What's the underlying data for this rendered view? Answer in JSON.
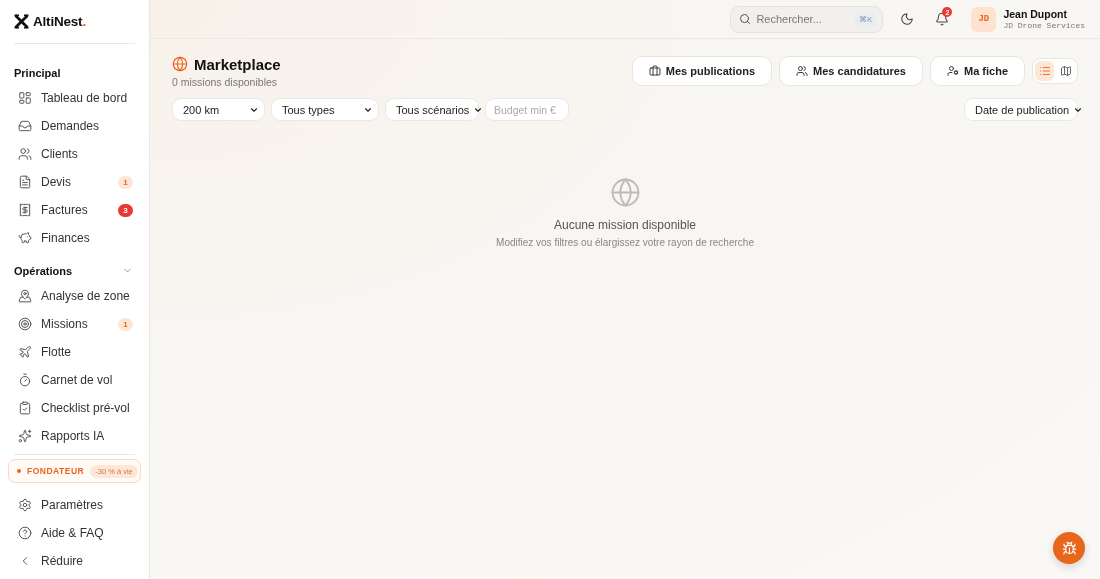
{
  "sidebar": {
    "logo": {
      "name": "AltiNest",
      "mark": "."
    },
    "sections": [
      {
        "title": "Principal",
        "items": [
          {
            "label": "Tableau de bord"
          },
          {
            "label": "Demandes"
          },
          {
            "label": "Clients"
          },
          {
            "label": "Devis",
            "badge": {
              "text": "1",
              "kind": "soft"
            }
          },
          {
            "label": "Factures",
            "badge": {
              "text": "3",
              "kind": "alert"
            }
          },
          {
            "label": "Finances"
          }
        ]
      },
      {
        "title": "Opérations",
        "expanded": true,
        "items": [
          {
            "label": "Analyse de zone"
          },
          {
            "label": "Missions",
            "badge": {
              "text": "1",
              "kind": "soft"
            }
          },
          {
            "label": "Flotte"
          },
          {
            "label": "Carnet de vol"
          },
          {
            "label": "Checklist pré-vol"
          },
          {
            "label": "Rapports IA"
          }
        ]
      }
    ],
    "plan": {
      "label": "FONDATEUR",
      "offer": "-30 % à vie"
    },
    "footer_items": [
      {
        "label": "Paramètres"
      },
      {
        "label": "Aide & FAQ"
      },
      {
        "label": "Réduire"
      }
    ]
  },
  "header": {
    "search": {
      "placeholder": "Rechercher...",
      "shortcut": "⌘K"
    },
    "notifications": {
      "count": "2"
    },
    "user": {
      "initials": "JD",
      "name": "Jean Dupont",
      "company": "JD Drone Services"
    }
  },
  "page": {
    "title": "Marketplace",
    "subtitle": "0 missions disponibles",
    "actions": [
      {
        "label": "Mes publications"
      },
      {
        "label": "Mes candidatures"
      },
      {
        "label": "Ma fiche"
      }
    ],
    "views": [
      {
        "kind": "list",
        "selected": true
      },
      {
        "kind": "map",
        "selected": false
      }
    ],
    "filters": [
      {
        "kind": "select",
        "value": "200 km"
      },
      {
        "kind": "select",
        "value": "Tous types"
      },
      {
        "kind": "select",
        "value": "Tous scénarios"
      },
      {
        "kind": "input",
        "placeholder": "Budget min €"
      }
    ],
    "sort": {
      "value": "Date de publication"
    },
    "empty_state": {
      "title": "Aucune mission disponible",
      "message": "Modifiez vos filtres ou élargissez votre rayon de recherche"
    }
  }
}
